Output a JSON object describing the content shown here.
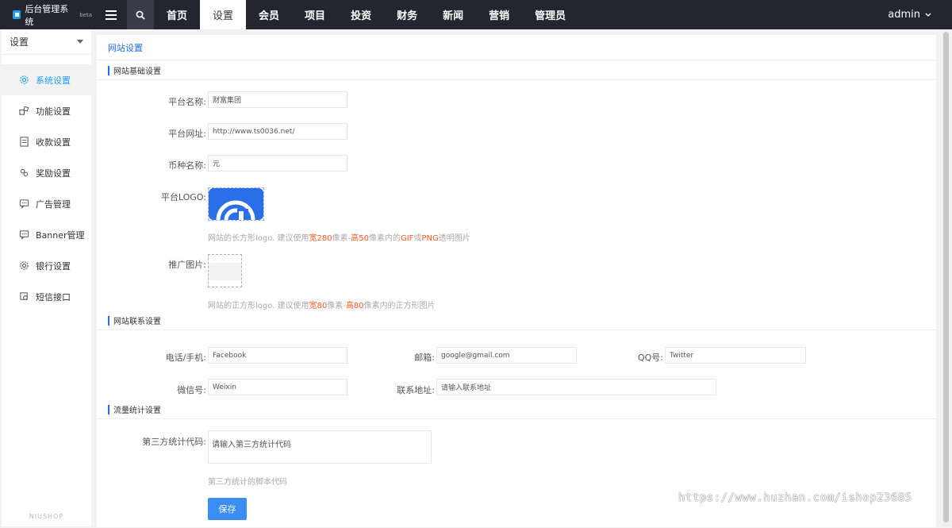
{
  "topbar": {
    "brand": "后台管理系统",
    "brand_tag": "beta",
    "nav": [
      "首页",
      "设置",
      "会员",
      "项目",
      "投资",
      "财务",
      "新闻",
      "营销",
      "管理员"
    ],
    "active_nav": 1,
    "user": "admin"
  },
  "sidebar": {
    "header": "设置",
    "items": [
      {
        "label": "系统设置",
        "icon": "gear-icon"
      },
      {
        "label": "功能设置",
        "icon": "function-icon"
      },
      {
        "label": "收款设置",
        "icon": "document-icon"
      },
      {
        "label": "奖励设置",
        "icon": "reward-icon"
      },
      {
        "label": "广告管理",
        "icon": "message-icon"
      },
      {
        "label": "Banner管理",
        "icon": "message-icon"
      },
      {
        "label": "银行设置",
        "icon": "gear-icon"
      },
      {
        "label": "短信接口",
        "icon": "sms-icon"
      }
    ],
    "footer": "NIUSHOP"
  },
  "breadcrumb": "网站设置",
  "sections": {
    "basic": "网站基础设置",
    "contact": "网站联系设置",
    "stats": "流量统计设置"
  },
  "basic": {
    "platform_name_label": "平台名称:",
    "platform_name_value": "财富集团",
    "platform_url_label": "平台网址:",
    "platform_url_value": "http://www.ts0036.net/",
    "currency_label": "币种名称:",
    "currency_value": "元",
    "logo_label": "平台LOGO:",
    "logo_hint": [
      "网站的长方形logo. 建议使用",
      "宽280",
      "像素-",
      "高50",
      "像素内的",
      "GIF",
      "或",
      "PNG",
      "透明图片"
    ],
    "promo_label": "推广图片:",
    "promo_hint": [
      "网站的正方形logo. 建议使用",
      "宽80",
      "像素-",
      "高80",
      "像素内的正方形图片"
    ]
  },
  "contact": {
    "phone_label": "电话/手机:",
    "phone_value": "Facebook",
    "email_label": "邮箱:",
    "email_value": "google@gmail.com",
    "qq_label": "QQ号:",
    "qq_value": "Twitter",
    "wechat_label": "微信号:",
    "wechat_value": "Weixin",
    "address_label": "联系地址:",
    "address_placeholder": "请输入联系地址"
  },
  "stats": {
    "code_label": "第三方统计代码:",
    "code_placeholder": "请输入第三方统计代码",
    "code_hint": "第三方统计的脚本代码"
  },
  "save_label": "保存",
  "watermark": "https://www.huzhan.com/ishop23685",
  "colors": {
    "accent": "#1e9fff",
    "highlight": "#ff5722",
    "topbar": "#23262e",
    "button": "#3a8ef5"
  }
}
